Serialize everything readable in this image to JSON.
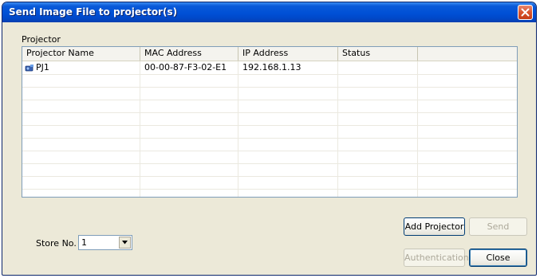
{
  "window": {
    "title": "Send Image File to projector(s)"
  },
  "projector_group": {
    "label": "Projector",
    "columns": [
      "Projector Name",
      "MAC Address",
      "IP Address",
      "Status"
    ],
    "rows": [
      {
        "name": "PJ1",
        "mac": "00-00-87-F3-02-E1",
        "ip": "192.168.1.13",
        "status": ""
      }
    ]
  },
  "buttons": {
    "add_projector": "Add Projector",
    "send": "Send",
    "authentication": "Authentication",
    "close": "Close"
  },
  "store": {
    "label": "Store No.",
    "value": "1"
  },
  "icons": {
    "close": "close-icon",
    "projector": "projector-icon",
    "dropdown": "chevron-down-icon"
  }
}
